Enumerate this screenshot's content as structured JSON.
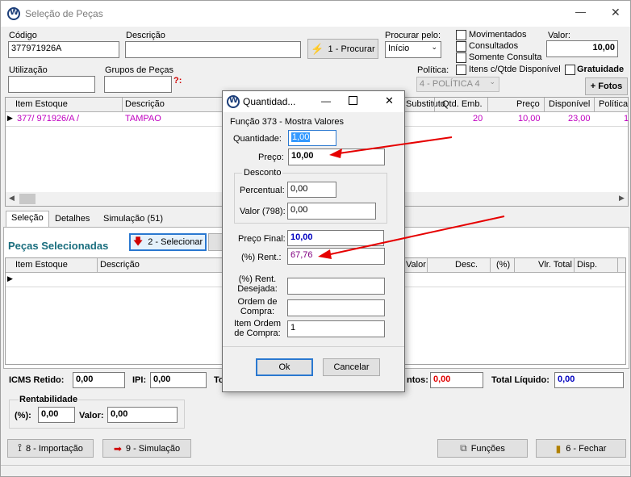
{
  "window": {
    "title": "Seleção de Peças",
    "minimize": "—",
    "close": "✕"
  },
  "top": {
    "codigo_label": "Código",
    "codigo_value": "377971926A",
    "descricao_label": "Descrição",
    "descricao_value": "",
    "procurar_button": "1 - Procurar",
    "procurar_pelo_label": "Procurar pelo:",
    "procurar_pelo_value": "Início",
    "movimentados": "Movimentados",
    "consultados": "Consultados",
    "somente_consulta": "Somente Consulta",
    "valor_label": "Valor:",
    "valor_value": "10,00",
    "utilizacao_label": "Utilização",
    "utilizacao_value": "",
    "grupos_label": "Grupos de Peças",
    "grupos_value": "",
    "grupos_icon": "?:",
    "politica_label": "Política:",
    "politica_value": "4 - POLÍTICA 4",
    "itens_qtde": "Itens c/Qtde Disponível",
    "gratuidade": "Gratuidade",
    "fotos_button": "+ Fotos"
  },
  "grid1": {
    "headers": [
      "Item Estoque",
      "Descrição",
      "Substituto",
      "Qtd. Emb.",
      "Preço",
      "Disponível",
      "Política"
    ],
    "row": {
      "item": "377/ 971926/A /",
      "descricao": "TAMPAO",
      "qtd": "20",
      "preco": "10,00",
      "disponivel": "23,00",
      "politica": "1"
    }
  },
  "tabs": [
    "Seleção",
    "Detalhes",
    "Simulação (51)"
  ],
  "selected": {
    "title": "Peças Selecionadas",
    "selecionar_button": "2 - Selecionar",
    "headers": [
      "Item Estoque",
      "Descrição",
      "Valor",
      "Desc.",
      "(%)",
      "Vlr. Total",
      "Disp."
    ]
  },
  "totals": {
    "icms_label": "ICMS Retido:",
    "icms_value": "0,00",
    "ipi_label": "IPI:",
    "ipi_value": "0,00",
    "to_label": "To",
    "descontos_label": "ntos:",
    "descontos_value": "0,00",
    "total_liquido_label": "Total Líquido:",
    "total_liquido_value": "0,00",
    "rentabilidade_label": "Rentabilidade",
    "pct_label": "(%):",
    "pct_value": "0,00",
    "valor_label": "Valor:",
    "valor_value": "0,00"
  },
  "bottom": {
    "importacao": "8 - Importação",
    "simulacao": "9 - Simulação",
    "funcoes": "Funções",
    "fechar": "6 - Fechar"
  },
  "dialog": {
    "title": "Quantidad...",
    "subtitle": "Função 373 - Mostra Valores",
    "quantidade_label": "Quantidade:",
    "quantidade_value": "1,00",
    "preco_label": "Preço:",
    "preco_value": "10,00",
    "desconto_group": "Desconto",
    "percentual_label": "Percentual:",
    "percentual_value": "0,00",
    "valor_label": "Valor (798):",
    "valor_value": "0,00",
    "preco_final_label": "Preço Final:",
    "preco_final_value": "10,00",
    "rent_label": "(%) Rent.:",
    "rent_value": "67,76",
    "rent_desejada_label_1": "(%) Rent.",
    "rent_desejada_label_2": "Desejada:",
    "rent_desejada_value": "",
    "ordem_label_1": "Ordem de",
    "ordem_label_2": "Compra:",
    "ordem_value": "",
    "item_ordem_label_1": "Item Ordem",
    "item_ordem_label_2": "de Compra:",
    "item_ordem_value": "1",
    "ok": "Ok",
    "cancelar": "Cancelar"
  },
  "colors": {
    "magenta": "#c000c0",
    "red": "#e00000",
    "blue": "#0000c0",
    "teal_title": "#1a6e7e",
    "arrow": "#e60000"
  }
}
